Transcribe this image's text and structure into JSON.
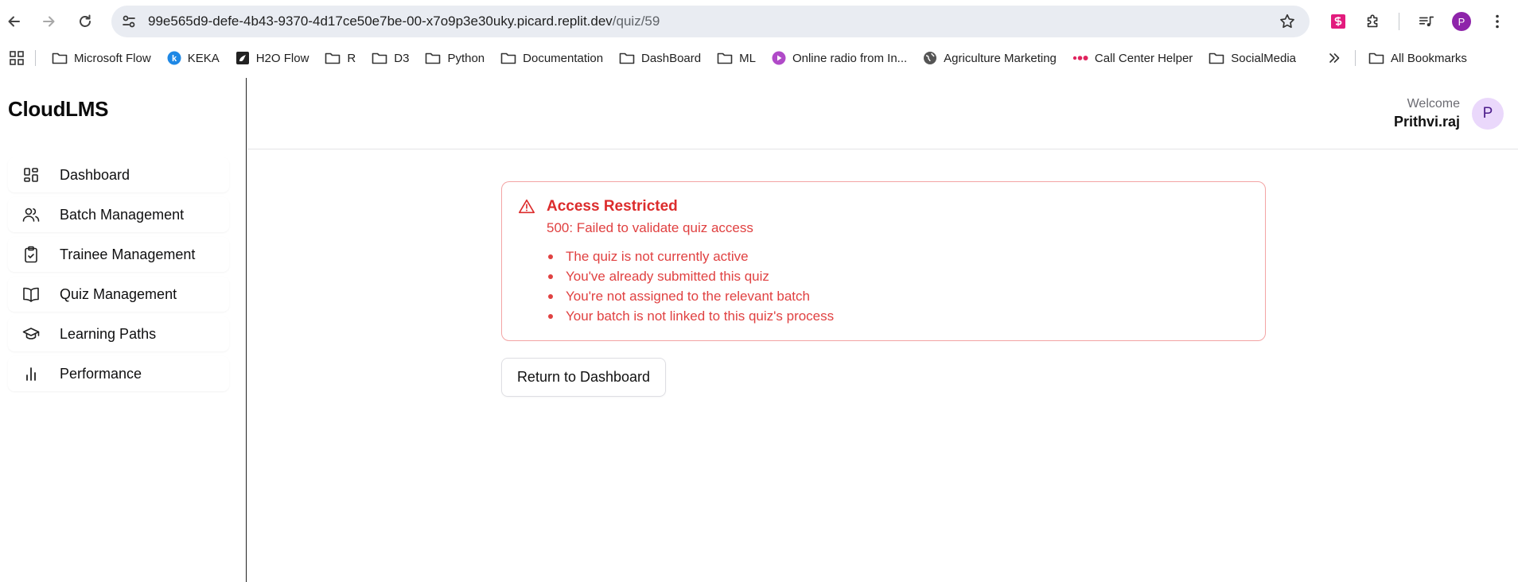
{
  "browser": {
    "url_host": "99e565d9-defe-4b43-9370-4d17ce50e7be-00-x7o9p3e30uky.picard.replit.dev",
    "url_path": "/quiz/59",
    "profile_initial": "P",
    "bookmarks": [
      {
        "label": "Microsoft Flow",
        "icon": "folder-icon"
      },
      {
        "label": "KEKA",
        "icon": "keka-icon"
      },
      {
        "label": "H2O Flow",
        "icon": "h2o-icon"
      },
      {
        "label": "R",
        "icon": "folder-icon"
      },
      {
        "label": "D3",
        "icon": "folder-icon"
      },
      {
        "label": "Python",
        "icon": "folder-icon"
      },
      {
        "label": "Documentation",
        "icon": "folder-icon"
      },
      {
        "label": "DashBoard",
        "icon": "folder-icon"
      },
      {
        "label": "ML",
        "icon": "folder-icon"
      },
      {
        "label": "Online radio from In...",
        "icon": "radio-icon"
      },
      {
        "label": "Agriculture Marketing",
        "icon": "globe-icon"
      },
      {
        "label": "Call Center Helper",
        "icon": "dots-icon"
      },
      {
        "label": "SocialMedia",
        "icon": "folder-icon"
      }
    ],
    "all_bookmarks_label": "All Bookmarks"
  },
  "app": {
    "brand": "CloudLMS",
    "menu": [
      {
        "label": "Dashboard",
        "icon": "dashboard-icon"
      },
      {
        "label": "Batch Management",
        "icon": "users-icon"
      },
      {
        "label": "Trainee Management",
        "icon": "clipboard-check-icon"
      },
      {
        "label": "Quiz Management",
        "icon": "book-open-icon"
      },
      {
        "label": "Learning Paths",
        "icon": "graduation-cap-icon"
      },
      {
        "label": "Performance",
        "icon": "bar-chart-icon"
      }
    ],
    "header": {
      "welcome_label": "Welcome",
      "user_name": "Prithvi.raj",
      "avatar_initial": "P"
    },
    "alert": {
      "title": "Access Restricted",
      "description": "500: Failed to validate quiz access",
      "reasons": [
        "The quiz is not currently active",
        "You've already submitted this quiz",
        "You're not assigned to the relevant batch",
        "Your batch is not linked to this quiz's process"
      ]
    },
    "return_button_label": "Return to Dashboard"
  },
  "colors": {
    "alert_red": "#dc2c2c",
    "alert_border": "#f3a4a4",
    "avatar_bg": "#ead8fb",
    "profile_purple": "#8e24aa"
  }
}
